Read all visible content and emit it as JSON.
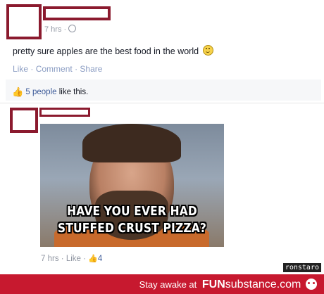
{
  "post": {
    "time": "7 hrs",
    "separator": "·",
    "privacy_icon": "globe-icon",
    "text": "pretty sure apples are the best food in the world",
    "emoji_icon": "smiley-icon",
    "actions": {
      "like": "Like",
      "comment": "Comment",
      "share": "Share",
      "sep": "·"
    },
    "likes": {
      "count_text": "5 people",
      "suffix": "like this."
    }
  },
  "comment": {
    "meme_caption_line1": "HAVE YOU EVER HAD",
    "meme_caption_line2": "STUFFED CRUST PIZZA?",
    "time": "7 hrs",
    "like": "Like",
    "sep": "·",
    "like_count": "4"
  },
  "watermark": "ronstaro",
  "footer": {
    "tagline": "Stay awake at",
    "brand_fun": "FUN",
    "brand_rest": "substance",
    "brand_tld": ".com"
  },
  "colors": {
    "redaction": "#8b1a2e",
    "footer_bg": "#c7192f",
    "link": "#8b9dc3",
    "facebook_blue": "#3b5998"
  }
}
